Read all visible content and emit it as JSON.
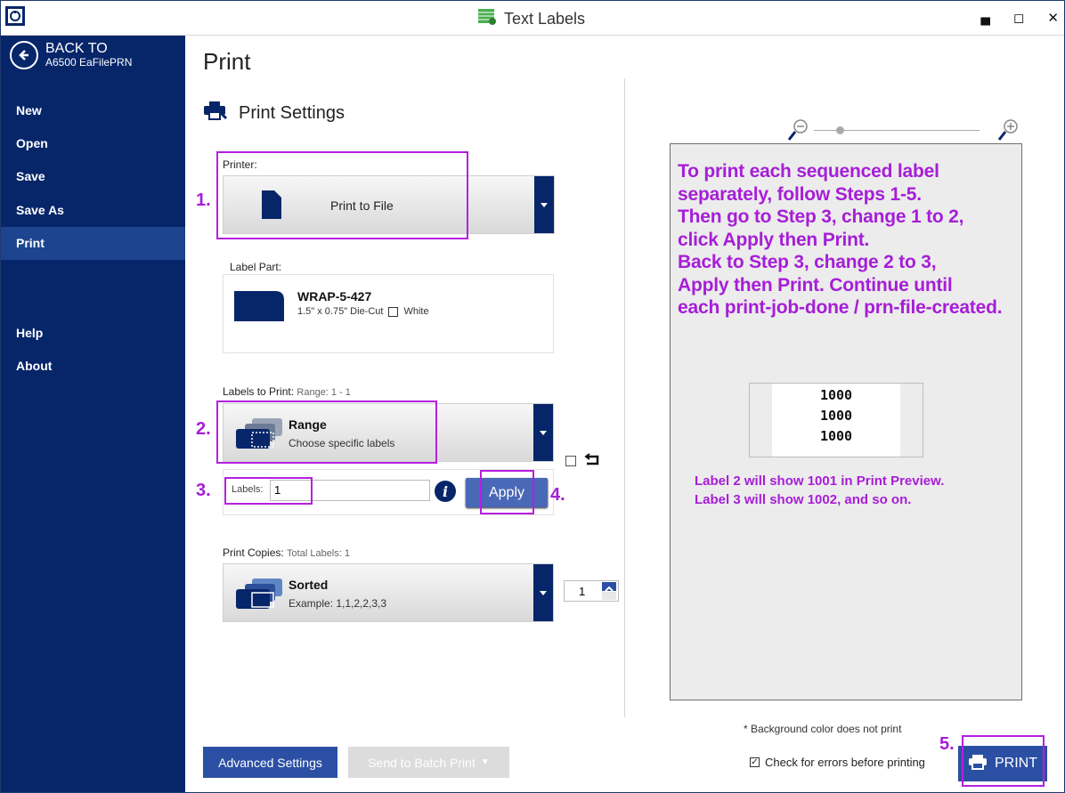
{
  "window": {
    "title": "Text Labels"
  },
  "sidebar": {
    "back_label": "BACK TO",
    "back_sub": "A6500 EaFilePRN",
    "items": [
      {
        "label": "New",
        "active": false
      },
      {
        "label": "Open",
        "active": false
      },
      {
        "label": "Save",
        "active": false
      },
      {
        "label": "Save As",
        "active": false
      },
      {
        "label": "Print",
        "active": true
      },
      {
        "label": "Help",
        "active": false
      },
      {
        "label": "About",
        "active": false
      }
    ]
  },
  "main": {
    "title": "Print",
    "section_title": "Print Settings",
    "printer": {
      "label": "Printer:",
      "value": "Print to File"
    },
    "label_part": {
      "label": "Label Part:",
      "name": "WRAP-5-427",
      "size": "1.5\" x 0.75\"  Die-Cut",
      "color": "White"
    },
    "labels_to_print": {
      "label": "Labels to Print:",
      "range_hint": "Range: 1 - 1",
      "value": "Range",
      "description": "Choose specific labels"
    },
    "labels_field": {
      "label": "Labels:",
      "value": "1"
    },
    "apply_label": "Apply",
    "print_copies": {
      "label": "Print Copies:",
      "total_hint": "Total Labels: 1",
      "value": "Sorted",
      "description": "Example: 1,1,2,2,3,3",
      "copies": "1"
    },
    "advanced_label": "Advanced Settings",
    "batch_label": "Send to Batch Print"
  },
  "steps": [
    "1.",
    "2.",
    "3.",
    "4.",
    "5."
  ],
  "preview": {
    "instructions": [
      "To print each sequenced label",
      "separately, follow Steps 1-5.",
      "Then go to Step 3, change 1 to 2,",
      "click Apply then Print.",
      "Back to Step 3, change 2 to 3,",
      "Apply then Print.  Continue until",
      "each print-job-done / prn-file-created."
    ],
    "label_lines": [
      "1000",
      "1000",
      "1000"
    ],
    "note_lines": [
      "Label 2 will show 1001 in Print Preview.",
      "Label 3 will show 1002, and so on."
    ]
  },
  "footer": {
    "bg_note": "* Background color does not print",
    "check_label": "Check for errors before printing",
    "print_label": "PRINT"
  },
  "colors": {
    "sidebar": "#07266a",
    "accent": "#2b4fa3",
    "callout": "#b61fe0"
  }
}
